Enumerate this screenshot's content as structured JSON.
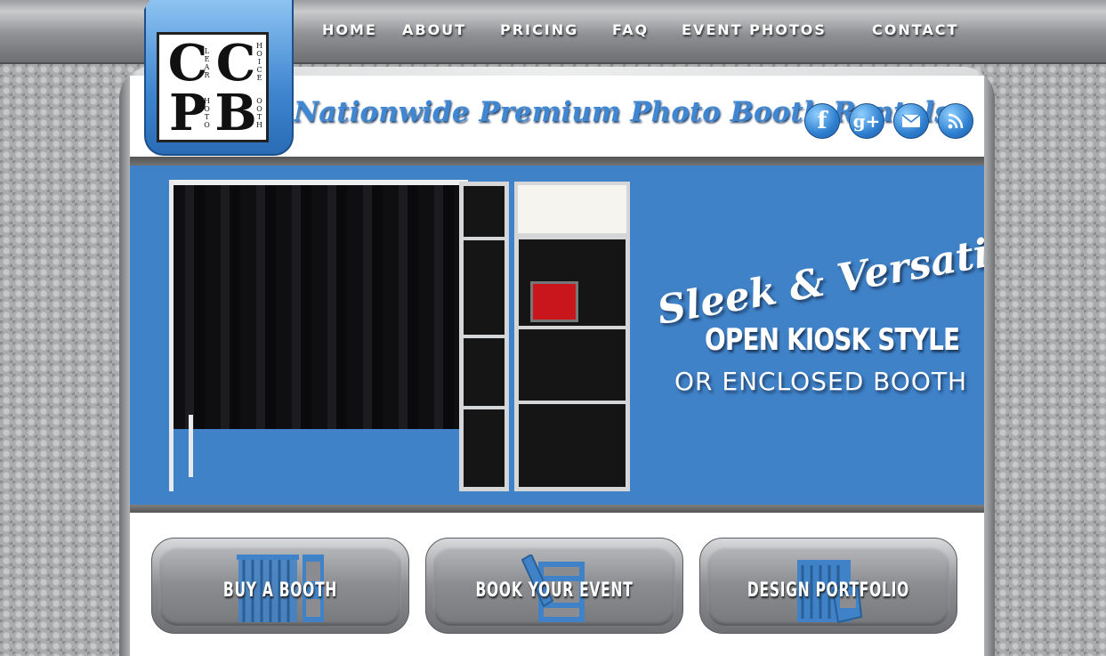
{
  "nav": {
    "items": [
      {
        "label": "HOME"
      },
      {
        "label": "ABOUT"
      },
      {
        "label": "PRICING"
      },
      {
        "label": "FAQ"
      },
      {
        "label": "EVENT PHOTOS"
      },
      {
        "label": "CONTACT"
      }
    ]
  },
  "logo": {
    "letters": [
      "C",
      "C",
      "P",
      "B"
    ],
    "words": [
      "LEAR",
      "HOICE",
      "HOTO",
      "OOTH"
    ]
  },
  "header": {
    "tagline": "Nationwide Premium Photo Booth Rentals",
    "social": [
      {
        "icon": "facebook-icon",
        "glyph": "f"
      },
      {
        "icon": "google-plus-icon",
        "glyph": "g+"
      },
      {
        "icon": "email-icon"
      },
      {
        "icon": "rss-icon"
      }
    ]
  },
  "hero": {
    "line1": "Sleek & Versatile!",
    "line2": "OPEN KIOSK STYLE",
    "line3": "OR ENCLOSED BOOTH"
  },
  "cta": [
    {
      "label": "BUY A BOOTH",
      "icon": "booth-icon"
    },
    {
      "label": "BOOK YOUR EVENT",
      "icon": "calendar-pen-icon"
    },
    {
      "label": "DESIGN PORTFOLIO",
      "icon": "design-icon"
    }
  ],
  "colors": {
    "accent": "#3f82c8",
    "tagline": "#3f86d3"
  }
}
